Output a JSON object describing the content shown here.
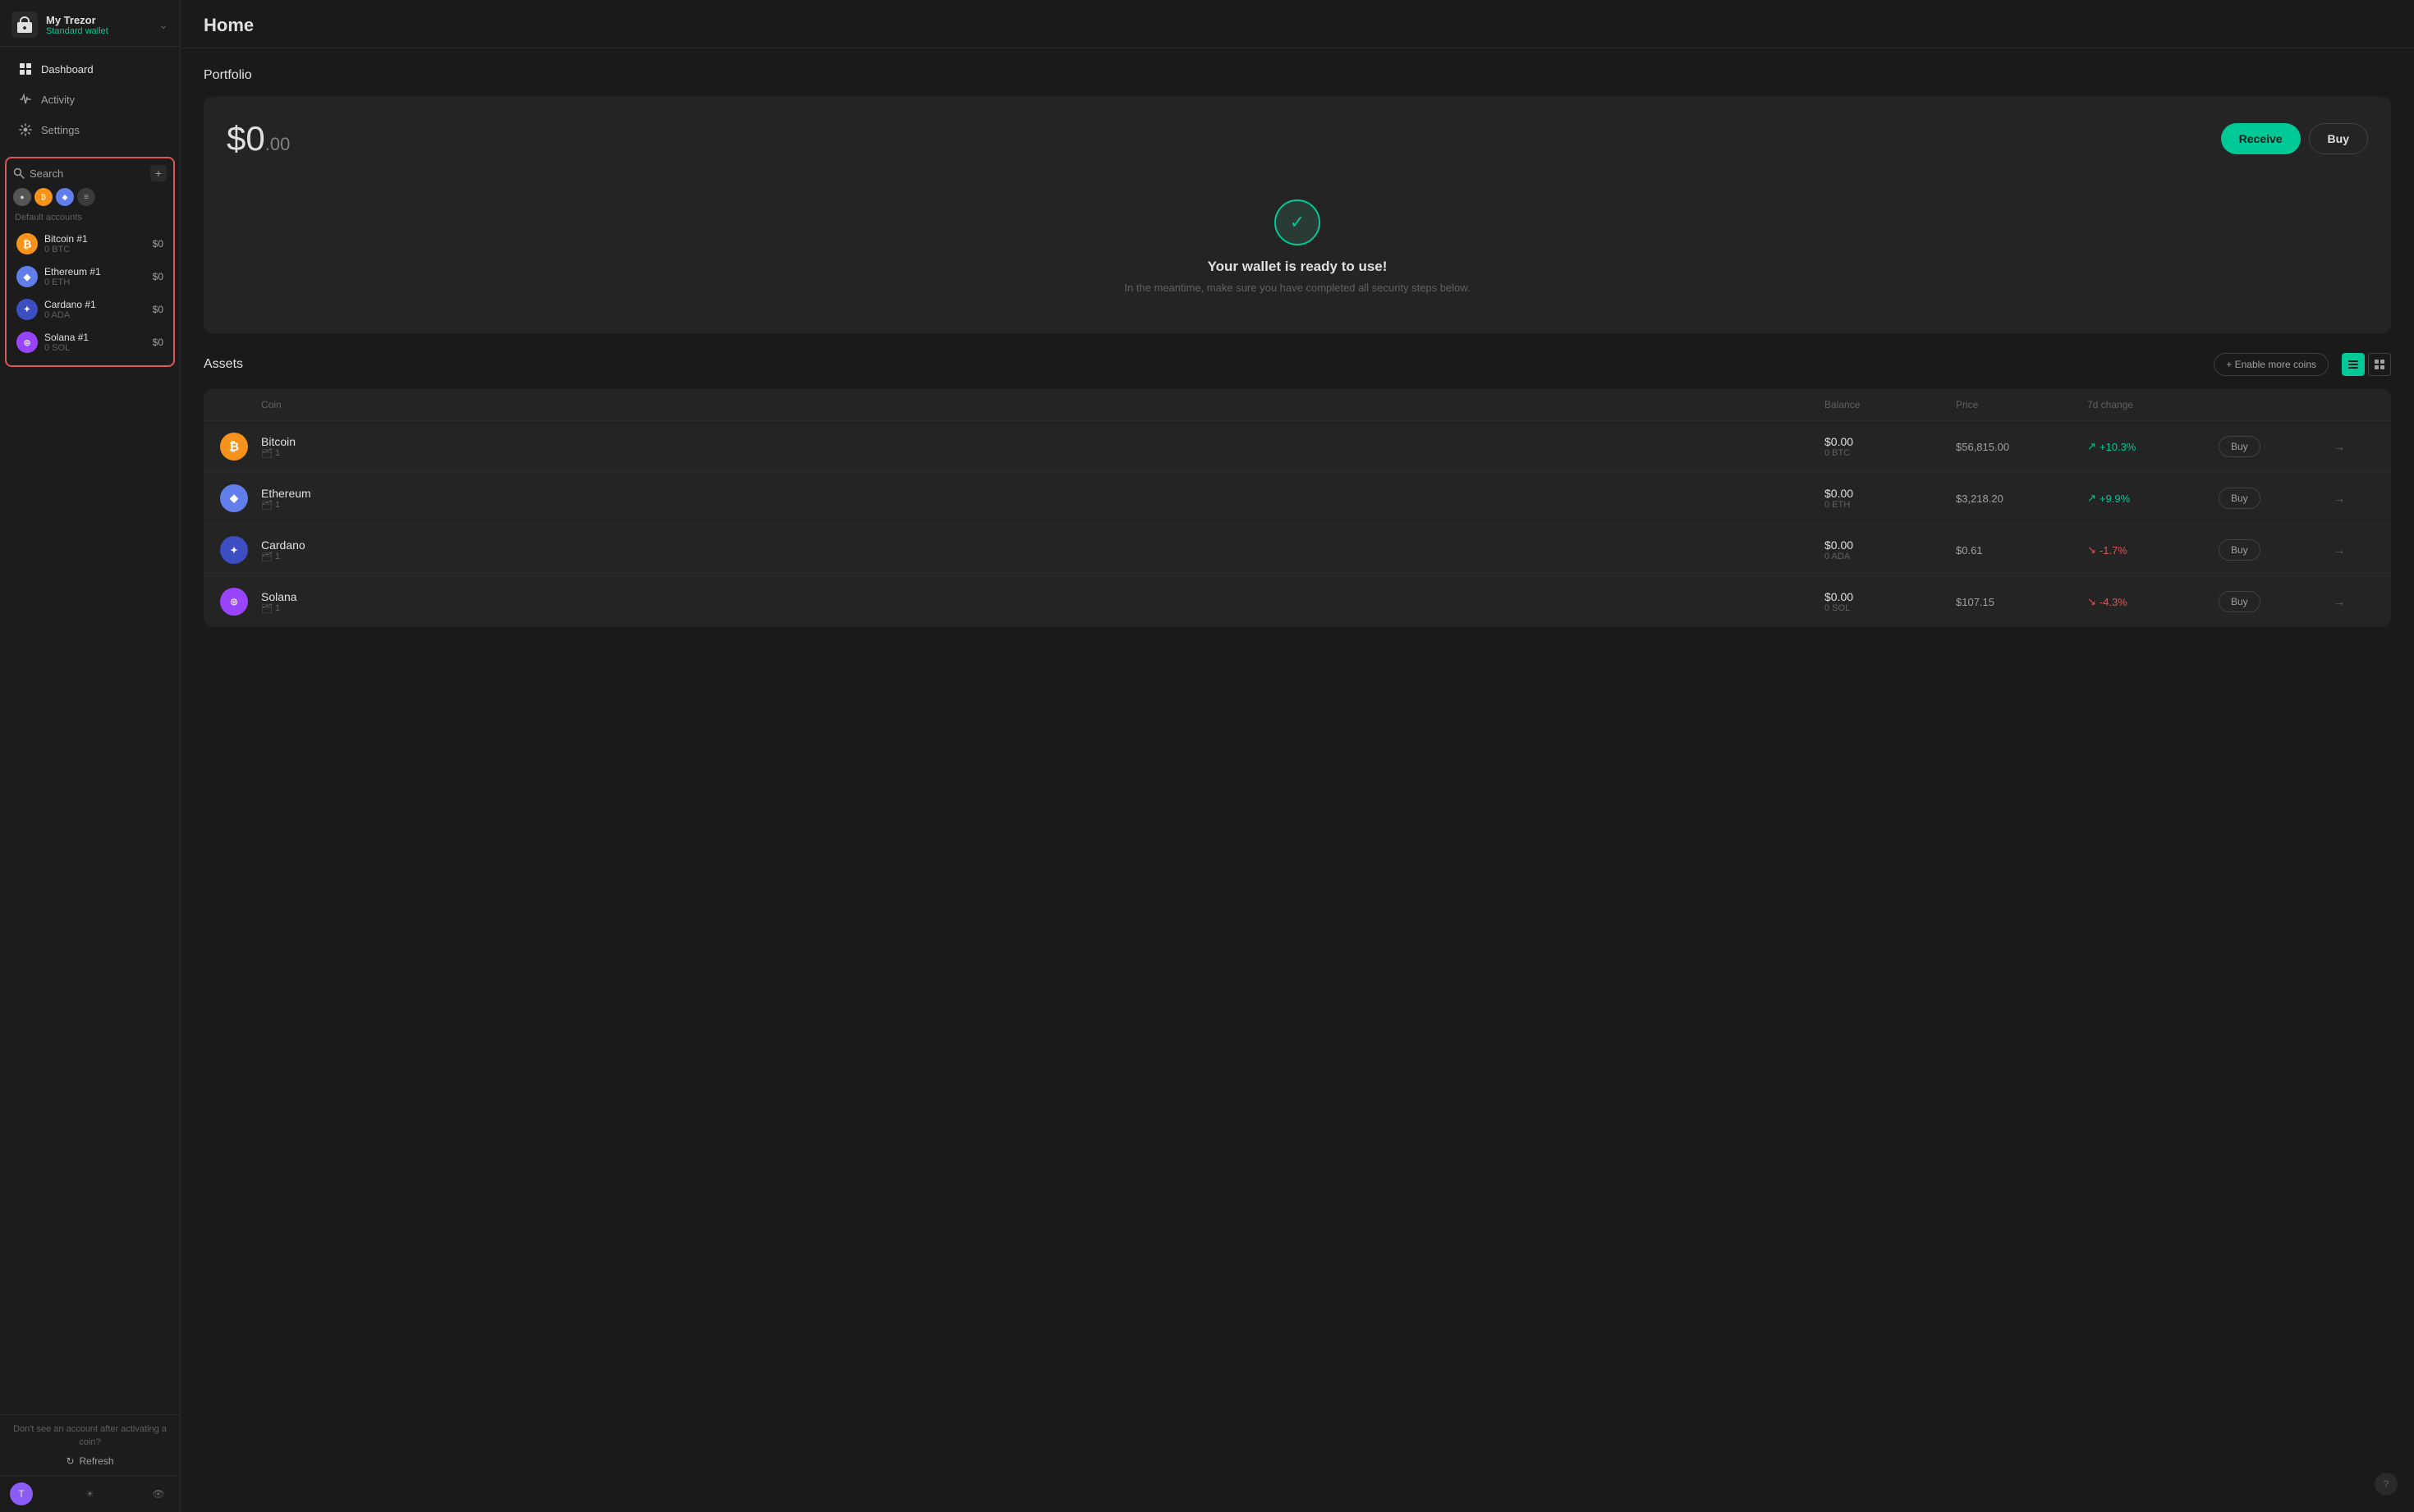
{
  "sidebar": {
    "wallet_name": "My Trezor",
    "wallet_type": "Standard wallet",
    "nav_items": [
      {
        "id": "dashboard",
        "label": "Dashboard",
        "active": true
      },
      {
        "id": "activity",
        "label": "Activity",
        "active": false
      },
      {
        "id": "settings",
        "label": "Settings",
        "active": false
      }
    ],
    "search_label": "Search",
    "add_label": "+",
    "default_accounts_label": "Default accounts",
    "accounts": [
      {
        "id": "btc",
        "name": "Bitcoin #1",
        "balance_crypto": "0 BTC",
        "balance_usd": "$0",
        "coin_class": "btc",
        "symbol": "₿"
      },
      {
        "id": "eth",
        "name": "Ethereum #1",
        "balance_crypto": "0 ETH",
        "balance_usd": "$0",
        "coin_class": "eth",
        "symbol": "◆"
      },
      {
        "id": "ada",
        "name": "Cardano #1",
        "balance_crypto": "0 ADA",
        "balance_usd": "$0",
        "coin_class": "ada",
        "symbol": "✦"
      },
      {
        "id": "sol",
        "name": "Solana #1",
        "balance_crypto": "0 SOL",
        "balance_usd": "$0",
        "coin_class": "sol",
        "symbol": "◎"
      }
    ],
    "refresh_hint": "Don't see an account after activating a coin?",
    "refresh_label": "↻ Refresh"
  },
  "header": {
    "title": "Home"
  },
  "portfolio": {
    "section_label": "Portfolio",
    "amount": "$0",
    "cents": ".00",
    "receive_btn": "Receive",
    "buy_btn": "Buy",
    "ready_title": "Your wallet is ready to use!",
    "ready_subtitle": "In the meantime, make sure you have completed all security steps below."
  },
  "assets": {
    "section_label": "Assets",
    "enable_more_btn": "+ Enable more coins",
    "columns": [
      "Coin",
      "Balance",
      "Price",
      "7d change",
      "",
      ""
    ],
    "rows": [
      {
        "coin": "Bitcoin",
        "coin_class": "btc",
        "symbol": "₿",
        "accounts": "1",
        "balance_usd": "$0.00",
        "balance_crypto": "0 BTC",
        "price": "$56,815.00",
        "change": "+10.3%",
        "change_type": "up",
        "buy_label": "Buy"
      },
      {
        "coin": "Ethereum",
        "coin_class": "eth",
        "symbol": "◆",
        "accounts": "1",
        "balance_usd": "$0.00",
        "balance_crypto": "0 ETH",
        "price": "$3,218.20",
        "change": "+9.9%",
        "change_type": "up",
        "buy_label": "Buy"
      },
      {
        "coin": "Cardano",
        "coin_class": "ada",
        "symbol": "✦",
        "accounts": "1",
        "balance_usd": "$0.00",
        "balance_crypto": "0 ADA",
        "price": "$0.61",
        "change": "-1.7%",
        "change_type": "down",
        "buy_label": "Buy"
      },
      {
        "coin": "Solana",
        "coin_class": "sol",
        "symbol": "◎",
        "accounts": "1",
        "balance_usd": "$0.00",
        "balance_crypto": "0 SOL",
        "price": "$107.15",
        "change": "-4.3%",
        "change_type": "down",
        "buy_label": "Buy"
      }
    ]
  },
  "bottom_icons": {
    "trezor_icon": "T",
    "brightness_icon": "☀",
    "eye_icon": "👁",
    "hint_icon": "?"
  }
}
